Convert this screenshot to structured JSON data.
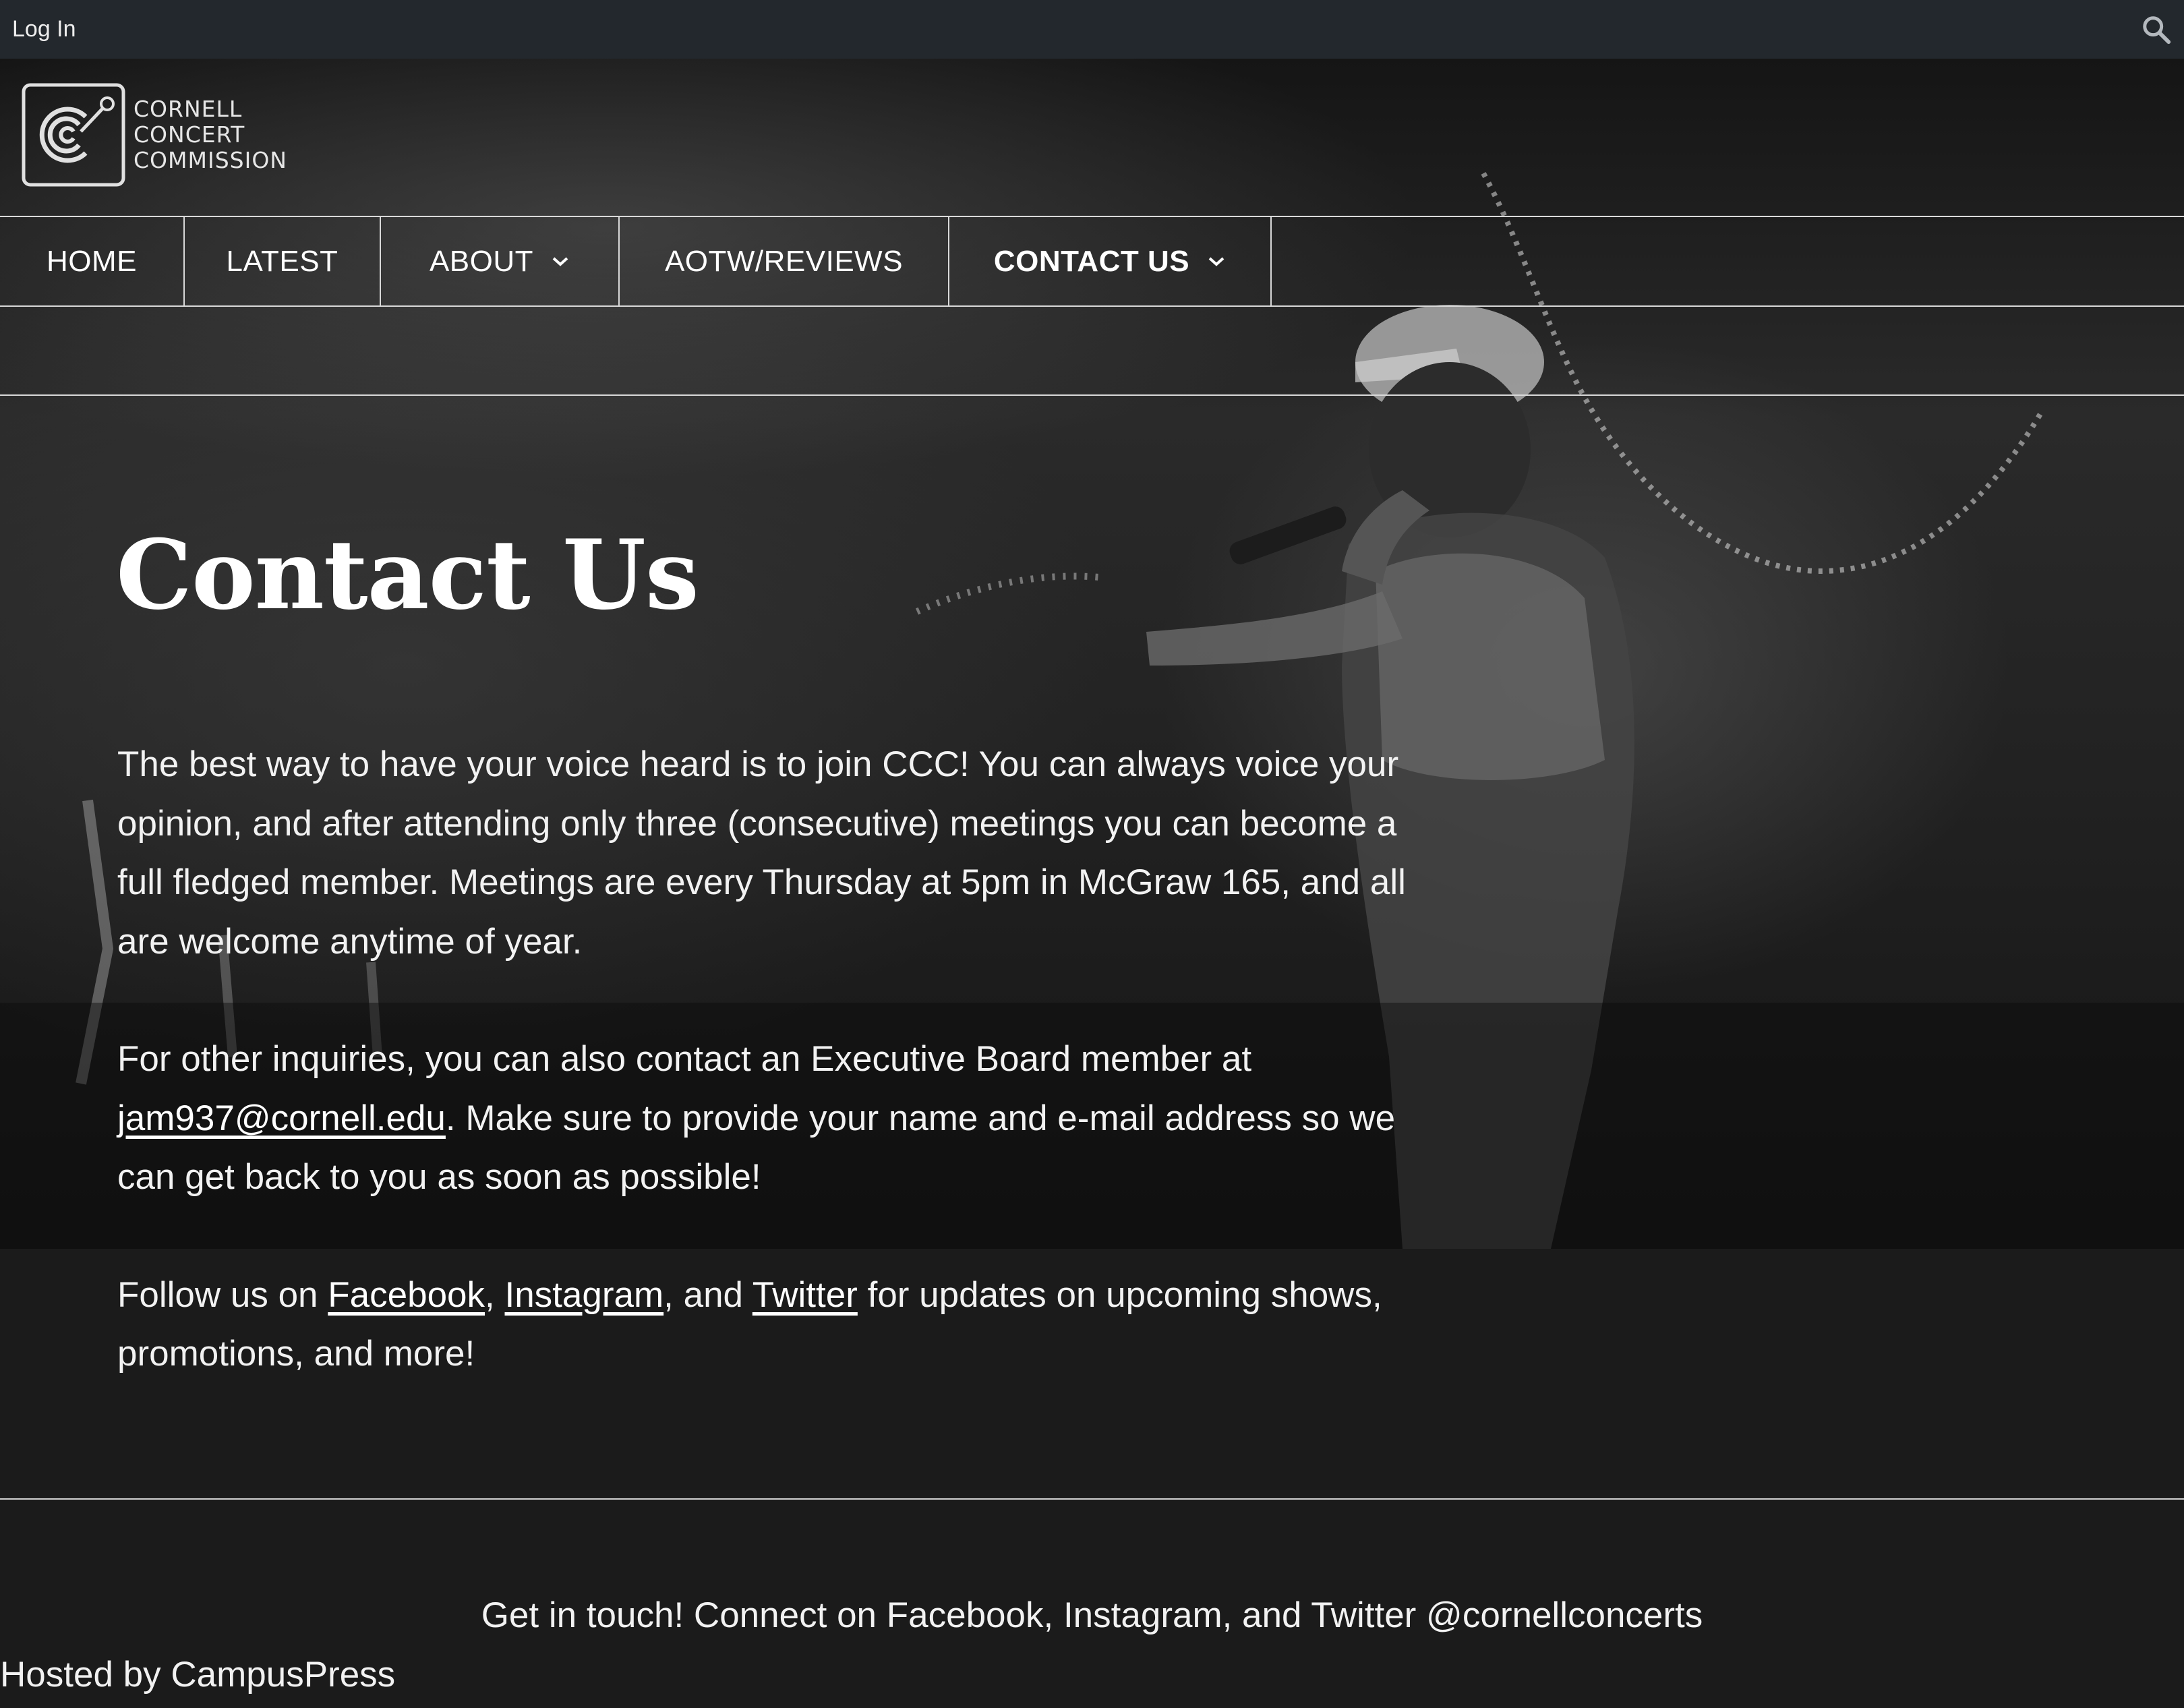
{
  "admin_bar": {
    "login_label": "Log In",
    "search_icon": "search-icon"
  },
  "site": {
    "logo_lines": [
      "CORNELL",
      "CONCERT",
      "COMMISSION"
    ]
  },
  "nav": {
    "items": [
      {
        "label": "HOME"
      },
      {
        "label": "LATEST"
      },
      {
        "label": "ABOUT",
        "dropdown": true
      },
      {
        "label": "AOTW/REVIEWS"
      },
      {
        "label": "CONTACT US",
        "dropdown": true,
        "active": true
      }
    ]
  },
  "page": {
    "title": "Contact Us",
    "p1": "The best way to have your voice heard is to join CCC! You can always voice your opinion, and after attending only three (consecutive) meetings you can become a full fledged member. Meetings are every Thursday at 5pm in McGraw 165, and all are welcome anytime of year.",
    "p2_before": "For other inquiries, you can also contact an Executive Board member at ",
    "p2_email": "jam937@cornell.edu",
    "p2_after": ". Make sure to provide your name and e-mail address so we can get back to you as soon as possible!",
    "p3_before": "Follow us on ",
    "p3_facebook": "Facebook",
    "p3_sep1": ", ",
    "p3_instagram": "Instagram",
    "p3_sep2": ", and ",
    "p3_twitter": "Twitter",
    "p3_after": " for updates on upcoming shows, promotions, and more!"
  },
  "footer": {
    "text": "Get in touch! Connect on Facebook, Instagram, and Twitter @cornellconcerts",
    "hosted": "Hosted by CampusPress"
  },
  "colors": {
    "admin_bar": "#23282d",
    "page_bg": "#1b1b1b",
    "text": "#ffffff",
    "rule": "#d9d9d9"
  }
}
